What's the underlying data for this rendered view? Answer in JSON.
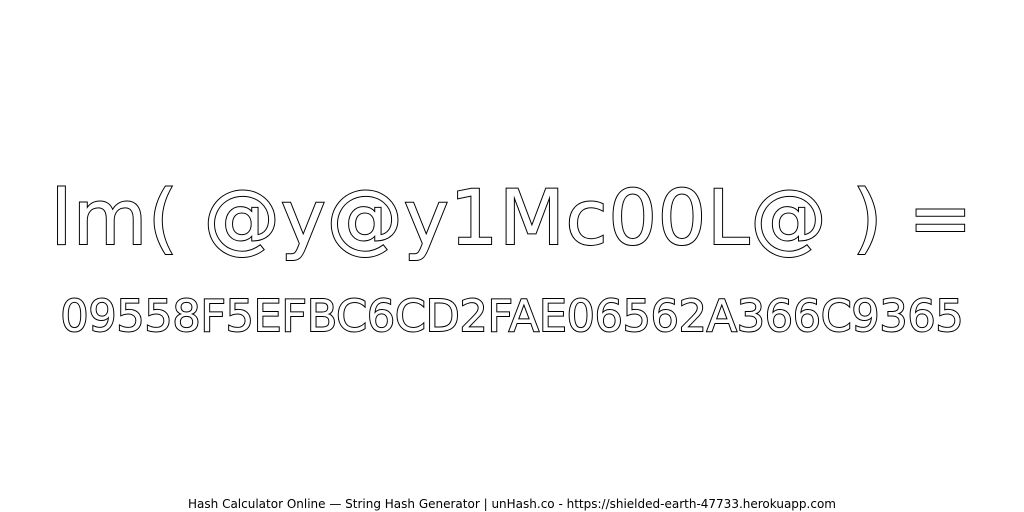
{
  "expression": "lm( @y@y1Mc00L@ ) =",
  "hash": "09558F5EFBC6CD2FAE06562A366C9365",
  "footer": "Hash Calculator Online — String Hash Generator | unHash.co - https://shielded-earth-47733.herokuapp.com",
  "colors": {
    "background": "#ffffff",
    "text_fill": "#ffffff",
    "text_outline": "#000000"
  }
}
